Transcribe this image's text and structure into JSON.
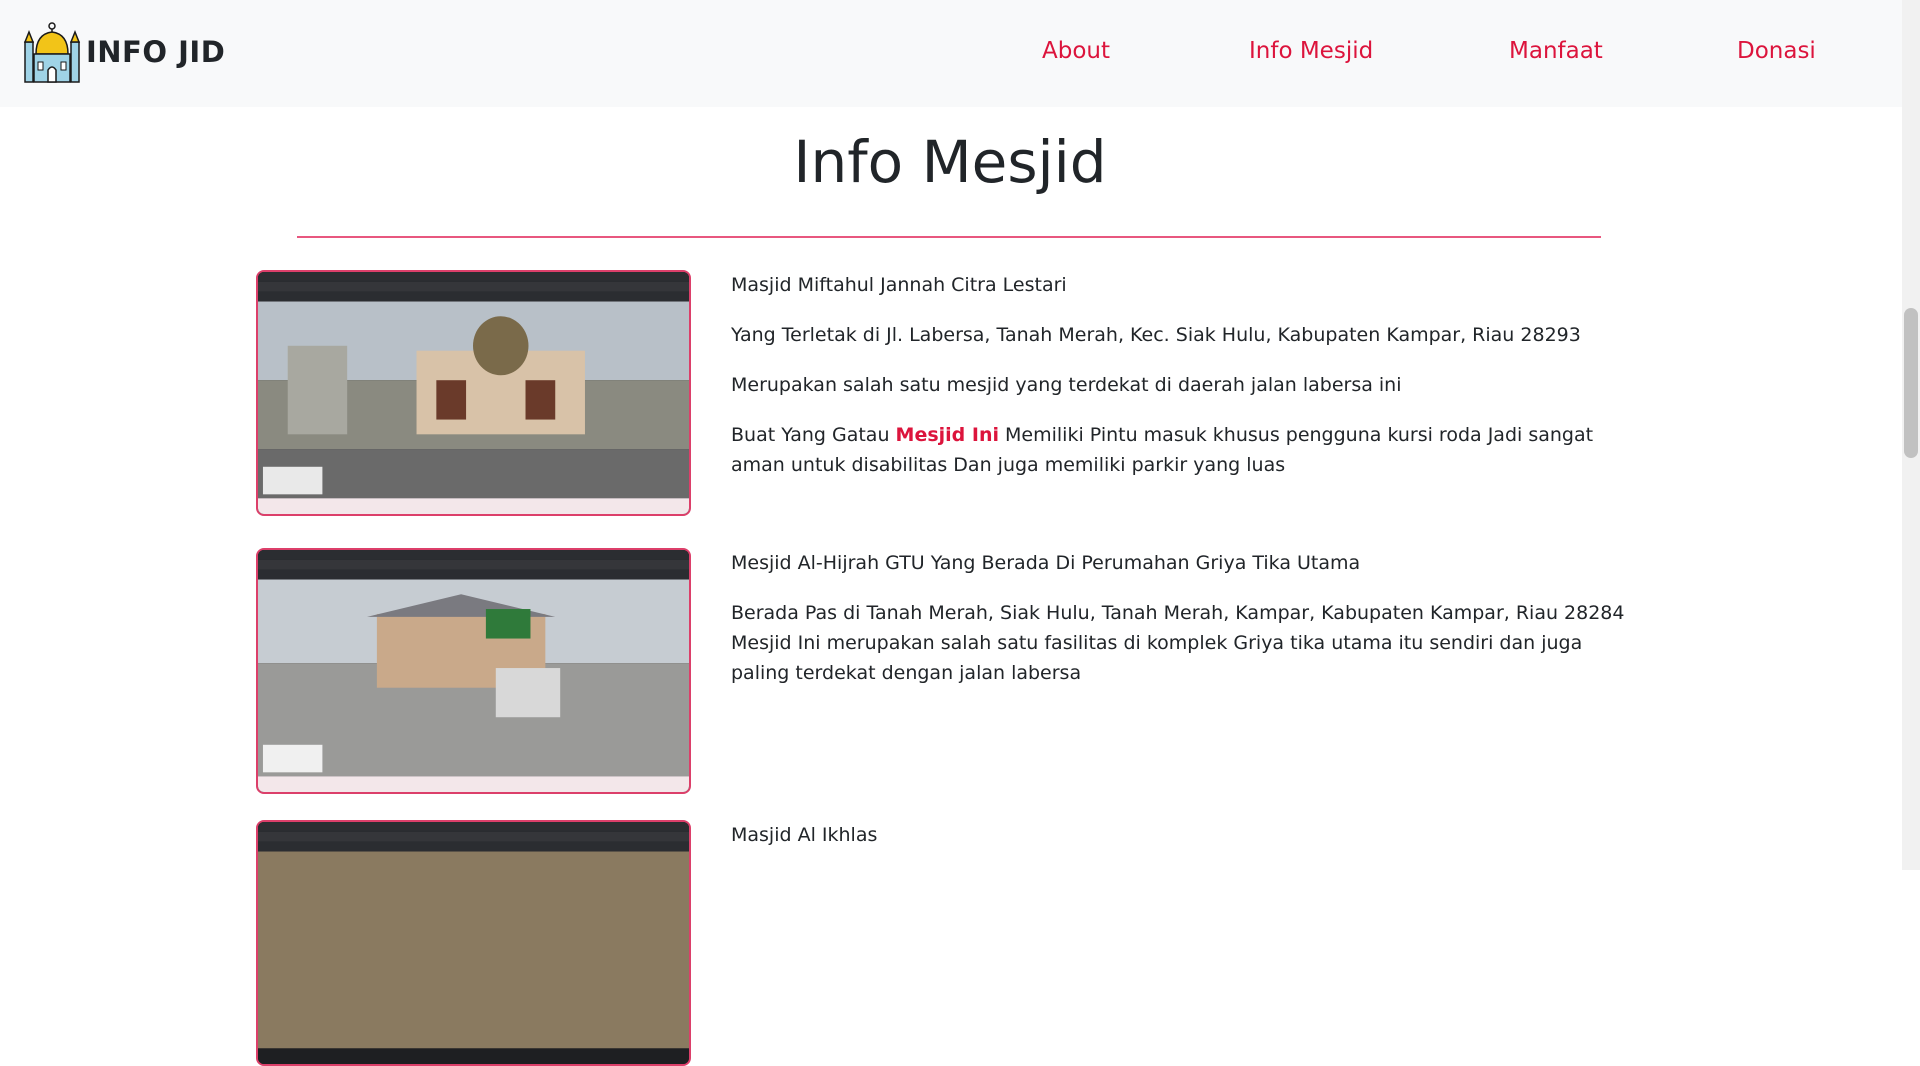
{
  "nav": {
    "brand": "INFO JID",
    "links": [
      "About",
      "Info Mesjid",
      "Manfaat",
      "Donasi"
    ]
  },
  "main": {
    "title": "Info Mesjid",
    "mosques": [
      {
        "name": "Masjid Miftahul Jannah Citra Lestari",
        "address": "Yang Terletak di Jl. Labersa, Tanah Merah, Kec. Siak Hulu, Kabupaten Kampar, Riau 28293",
        "note": "Merupakan salah satu mesjid yang terdekat di daerah jalan labersa ini",
        "extra_pre": "Buat Yang Gatau ",
        "extra_highlight": "Mesjid Ini",
        "extra_post": " Memiliki Pintu masuk khusus pengguna kursi roda Jadi sangat aman untuk disabilitas Dan juga memiliki parkir yang luas"
      },
      {
        "name": "Mesjid Al-Hijrah GTU Yang Berada Di Perumahan Griya Tika Utama",
        "address": "Berada Pas di Tanah Merah, Siak Hulu, Tanah Merah, Kampar, Kabupaten Kampar, Riau 28284 Mesjid Ini merupakan salah satu fasilitas di komplek Griya tika utama itu sendiri dan juga paling terdekat dengan jalan labersa"
      },
      {
        "name": "Masjid Al Ikhlas"
      }
    ]
  },
  "colors": {
    "accent": "#dc143c",
    "divider": "#e8577f",
    "navbar_bg": "#f8f9fa"
  }
}
